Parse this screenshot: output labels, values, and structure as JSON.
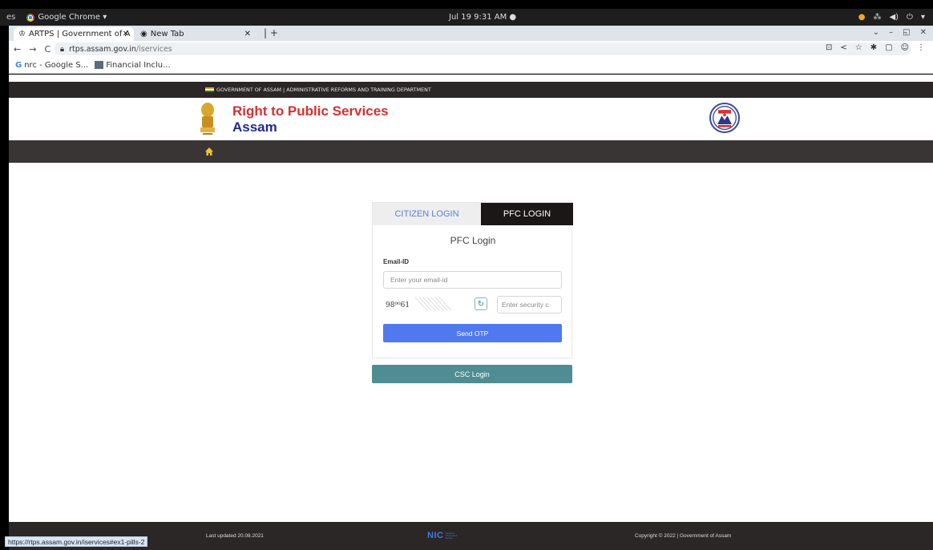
{
  "os": {
    "activities": "es",
    "app_name": "Google Chrome ▾",
    "clock": "Jul 19  9:31 AM  ●",
    "tray_icons": [
      "chrome-icon",
      "network-icon",
      "volume-icon",
      "power-icon",
      "chevron-down-icon"
    ]
  },
  "browser": {
    "tabs": [
      {
        "title": "ARTPS | Government of A",
        "active": true
      },
      {
        "title": "New Tab",
        "active": false
      }
    ],
    "address": {
      "host": "rtps.assam.gov.in",
      "path": "/iservices"
    },
    "bookmarks": [
      {
        "label": "nrc - Google S...",
        "icon": "google-icon"
      },
      {
        "label": "Financial Inclu...",
        "icon": "bookmark-favicon"
      }
    ],
    "status_url": "https://rtps.assam.gov.in/iservices#ex1-pills-2"
  },
  "site": {
    "gov_strip": "GOVERNMENT OF ASSAM | ADMINISTRATIVE REFORMS AND TRAINING DEPARTMENT",
    "title": "Right to Public Services",
    "subtitle": "Assam",
    "logo_alt": "KOHARI"
  },
  "login": {
    "tabs": {
      "citizen": "CITIZEN LOGIN",
      "pfc": "PFC LOGIN"
    },
    "heading": "PFC Login",
    "email_label": "Email-ID",
    "email_placeholder": "Enter your email-id",
    "captcha_text": "98⁰⁰61",
    "security_placeholder": "Enter security c",
    "send_otp": "Send OTP",
    "csc_login": "CSC Login"
  },
  "footer": {
    "updated": "Last updated 20.08.2021",
    "nic": "NIC",
    "nic_sub": "National Informatics Centre",
    "copyright": "Copyright © 2022 | Government of Assam"
  }
}
